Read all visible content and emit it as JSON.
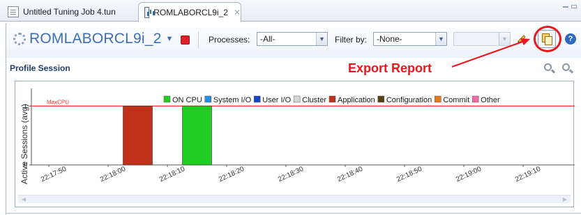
{
  "tabs": [
    {
      "label": "Untitled Tuning Job 4.tun",
      "active": false,
      "icon": "document-icon"
    },
    {
      "label": "ROMLABORCL9i_2",
      "active": true,
      "icon": "chart-icon",
      "close_symbol": "✕"
    }
  ],
  "toolbar": {
    "session_name": "ROMLABORCL9i_2",
    "processes_label": "Processes:",
    "processes_value": "-All-",
    "filter_label": "Filter by:",
    "filter_value": "-None-",
    "filter_secondary_value": ""
  },
  "section": {
    "title": "Profile Session"
  },
  "annotation": {
    "text": "Export Report",
    "color": "#e6181e"
  },
  "colors": {
    "accent": "#3f6fb3",
    "stop": "#e01f2b",
    "maxcpu_line": "#ff3030"
  },
  "chart_data": {
    "type": "bar",
    "ylabel": "Active Sessions (avg)",
    "yticks": [
      "0",
      "1"
    ],
    "ylim": [
      0,
      1.3
    ],
    "threshold": {
      "label": "MaxCPU",
      "value": 1
    },
    "legend": [
      {
        "name": "ON CPU",
        "color": "#22cc22"
      },
      {
        "name": "System I/O",
        "color": "#2b8fe0"
      },
      {
        "name": "User I/O",
        "color": "#1545c8"
      },
      {
        "name": "Cluster",
        "color": "#d6d6d6"
      },
      {
        "name": "Application",
        "color": "#c0311c"
      },
      {
        "name": "Configuration",
        "color": "#5a3e12"
      },
      {
        "name": "Commit",
        "color": "#e07a22"
      },
      {
        "name": "Other",
        "color": "#f06aa8"
      }
    ],
    "x_ticks": [
      "22:17:50",
      "22:18:00",
      "22:18:10",
      "22:18:20",
      "22:18:30",
      "22:18:40",
      "22:18:50",
      "22:19:00",
      "22:19:10"
    ],
    "bars": [
      {
        "x": "22:18:05",
        "series": "Application",
        "value": 1.0
      },
      {
        "x": "22:18:15",
        "series": "ON CPU",
        "value": 1.0
      }
    ]
  }
}
